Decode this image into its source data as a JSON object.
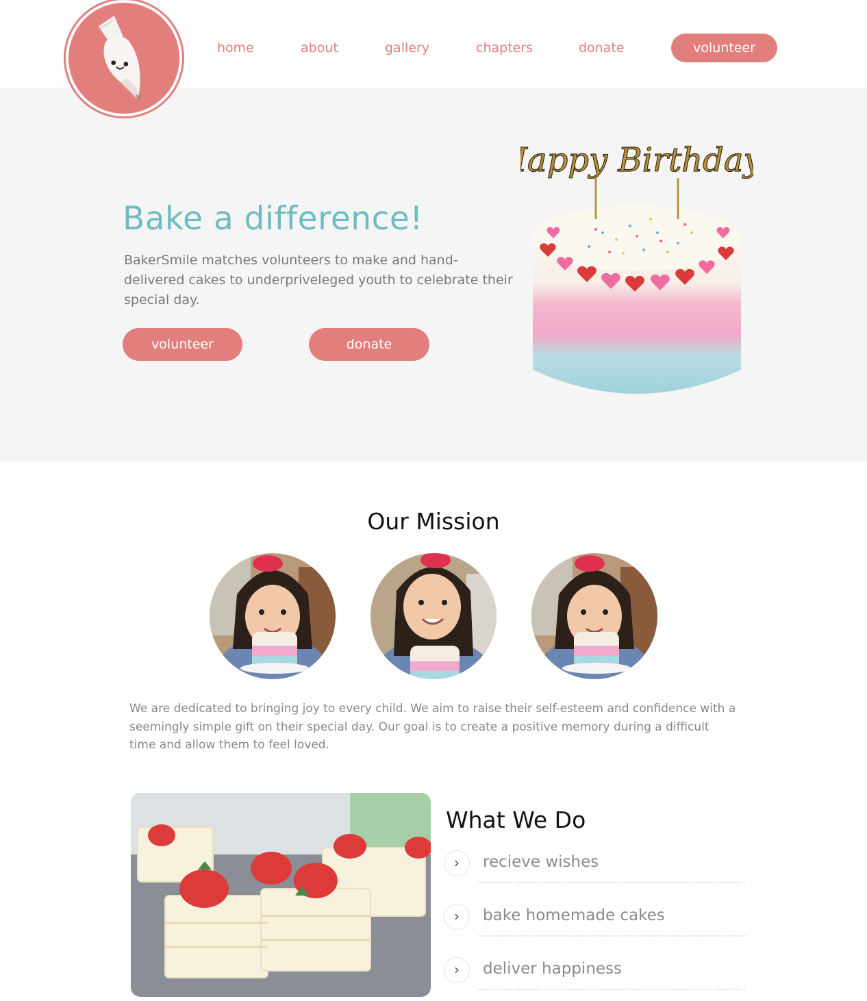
{
  "brand": {
    "accent_color": "#e27f7c",
    "title_color": "#6fbcc0",
    "logo_icon": "piping-bag-mascot-icon"
  },
  "nav": {
    "items": [
      {
        "label": "home"
      },
      {
        "label": "about"
      },
      {
        "label": "gallery"
      },
      {
        "label": "chapters"
      },
      {
        "label": "donate"
      }
    ],
    "cta_label": "volunteer"
  },
  "hero": {
    "title": "Bake a difference!",
    "text": "BakerSmile matches volunteers to make and hand-delivered cakes to underpriveleged youth to celebrate their special day.",
    "primary_button": "volunteer",
    "secondary_button": "donate",
    "cake_topper": "Happy Birthday!"
  },
  "mission": {
    "title": "Our Mission",
    "text": "We are dedicated to bringing joy to every child. We aim to raise their self-esteem and confidence with a seemingly simple gift on their special day. Our goal is to create a positive memory during a difficult time and allow them to feel loved."
  },
  "what_we_do": {
    "title": "What We Do",
    "items": [
      {
        "label": "recieve wishes",
        "icon": "chevron-right-icon"
      },
      {
        "label": "bake homemade cakes",
        "icon": "chevron-right-icon"
      },
      {
        "label": "deliver happiness",
        "icon": "chevron-right-icon"
      }
    ]
  }
}
